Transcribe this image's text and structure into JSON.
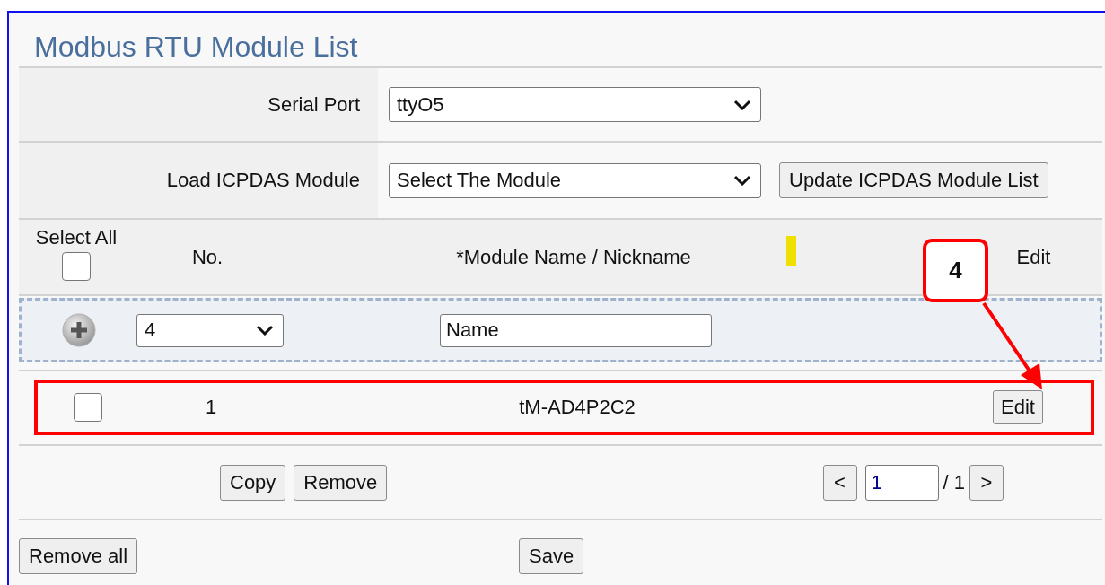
{
  "title": "Modbus RTU Module List",
  "serial_port": {
    "label": "Serial Port",
    "value": "ttyO5"
  },
  "load_module": {
    "label": "Load ICPDAS Module",
    "value": "Select The Module",
    "button": "Update ICPDAS Module List"
  },
  "columns": {
    "select_all": "Select All",
    "number": "No.",
    "name": "*Module Name / Nickname",
    "edit": "Edit"
  },
  "select_all_checked": false,
  "new_row": {
    "number": "4",
    "name": "Name"
  },
  "modules": [
    {
      "checked": false,
      "number": "1",
      "name": "tM-AD4P2C2",
      "edit": "Edit",
      "highlighted": true
    }
  ],
  "actions": [
    "Copy",
    "Remove"
  ],
  "pager": {
    "prev": "<",
    "page": "1",
    "total": "/ 1",
    "next": ">"
  },
  "footer": {
    "remove_all": "Remove all",
    "save": "Save"
  },
  "callout": {
    "label": "4"
  }
}
